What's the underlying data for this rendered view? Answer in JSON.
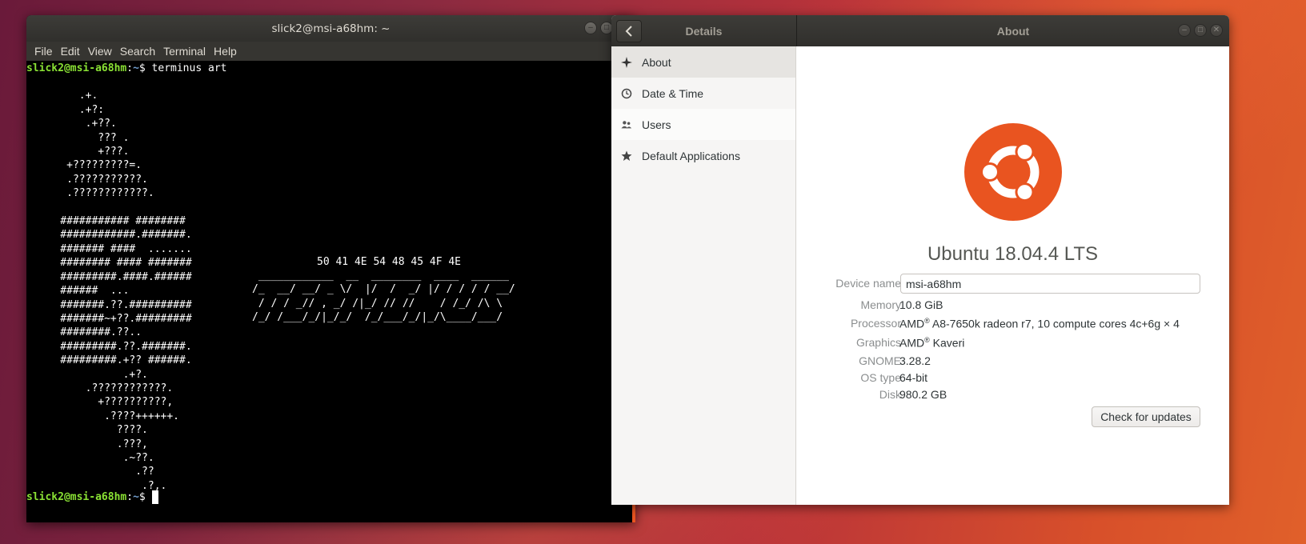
{
  "colors": {
    "accent": "#e95420",
    "prompt_user": "#8ae234",
    "prompt_path": "#729fcf",
    "terminal_bg": "#000000",
    "titlebar_bg": "#302f2c"
  },
  "terminal": {
    "title": "slick2@msi-a68hm: ~",
    "menu": [
      "File",
      "Edit",
      "View",
      "Search",
      "Terminal",
      "Help"
    ],
    "prompt_user": "slick2@msi-a68hm",
    "prompt_sep": ":",
    "prompt_path": "~",
    "prompt_symbol": "$ ",
    "command": "terminus art",
    "art": "\n       .+.\n       .+?:\n        .+??.\n          ??? .\n          +???.\n     +?????????=.\n     .???????????.\n     .????????????.\n\n    ########### ########\n    ############.#######.\n    ####### ####  .......\n    ######## #### #######\n    #########.####.######\n    ######  ...\n    #######.??.##########\n    #######~+??.#########\n    ########.??..\n    #########.??.#######.\n    #########.+?? ######.\n              .+?.\n        .????????????.\n          +??????????,\n           .????++++++.\n             ????.\n             .???,\n              .~??.\n                .??\n                 .?,.",
    "hex": "50 41 4E 54 48 45 4F 4E",
    "banner": " ____________  __  ________  ____  ______\n/_  __/ __/ _ \\/  |/  /  _/ |/ / / / / __/\n / / / _// , _/ /|_/ // //    / /_/ /\\ \\\n/_/ /___/_/|_/_/  /_/___/_/|_/\\____/___/"
  },
  "settings": {
    "sidebar_title": "Details",
    "page_title": "About",
    "sidebar": [
      {
        "label": "About",
        "icon": "sparkle-icon"
      },
      {
        "label": "Date & Time",
        "icon": "clock-icon"
      },
      {
        "label": "Users",
        "icon": "users-icon"
      },
      {
        "label": "Default Applications",
        "icon": "star-icon"
      }
    ],
    "os_name": "Ubuntu 18.04.4 LTS",
    "labels": {
      "device_name": "Device name",
      "memory": "Memory",
      "processor": "Processor",
      "graphics": "Graphics",
      "gnome": "GNOME",
      "os_type": "OS type",
      "disk": "Disk"
    },
    "values": {
      "device_name": "msi-a68hm",
      "memory": "10.8 GiB",
      "processor_brand": "AMD",
      "processor_mark": "®",
      "processor_rest": " A8-7650k radeon r7, 10 compute cores 4c+6g × 4",
      "graphics_brand": "AMD",
      "graphics_mark": "®",
      "graphics_rest": " Kaveri",
      "gnome": "3.28.2",
      "os_type": "64-bit",
      "disk": "980.2 GB"
    },
    "check_updates_label": "Check for updates"
  }
}
